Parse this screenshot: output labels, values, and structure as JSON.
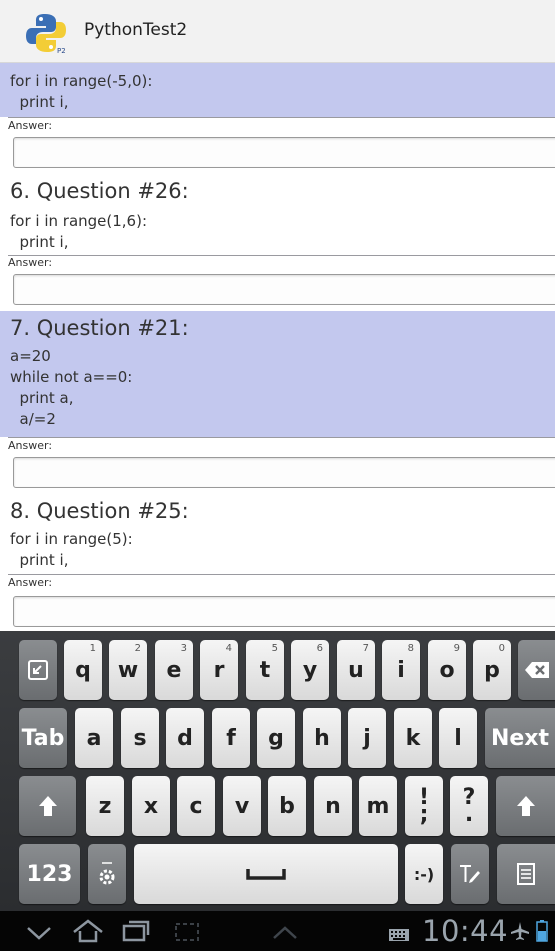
{
  "app": {
    "title": "PythonTest2"
  },
  "questions": [
    {
      "title": "",
      "code": "for i in range(-5,0):\n  print i,",
      "answer_label": "Answer:",
      "answer_value": "",
      "highlighted": true
    },
    {
      "title": "6. Question #26:",
      "code": "for i in range(1,6):\n  print i,",
      "answer_label": "Answer:",
      "answer_value": "",
      "highlighted": false
    },
    {
      "title": "7. Question #21:",
      "code": "a=20\nwhile not a==0:\n  print a,\n  a/=2",
      "answer_label": "Answer:",
      "answer_value": "",
      "highlighted": true
    },
    {
      "title": "8. Question #25:",
      "code": "for i in range(5):\n  print i,",
      "answer_label": "Answer:",
      "answer_value": "",
      "highlighted": false
    }
  ],
  "keyboard": {
    "row1": [
      {
        "label": "q",
        "hint": "1"
      },
      {
        "label": "w",
        "hint": "2"
      },
      {
        "label": "e",
        "hint": "3"
      },
      {
        "label": "r",
        "hint": "4"
      },
      {
        "label": "t",
        "hint": "5"
      },
      {
        "label": "y",
        "hint": "6"
      },
      {
        "label": "u",
        "hint": "7"
      },
      {
        "label": "i",
        "hint": "8"
      },
      {
        "label": "o",
        "hint": "9"
      },
      {
        "label": "p",
        "hint": "0"
      }
    ],
    "row2": [
      "a",
      "s",
      "d",
      "f",
      "g",
      "h",
      "j",
      "k",
      "l"
    ],
    "row3": [
      "z",
      "x",
      "c",
      "v",
      "b",
      "n",
      "m"
    ],
    "tab_label": "Tab",
    "next_label": "Next",
    "num_label": "123",
    "smiley_label": ":-)",
    "punct1": "!\n;",
    "punct2": "?\n."
  },
  "status": {
    "time": "10:44"
  },
  "icons": [
    "python-logo-icon",
    "keyboard-switch-icon",
    "backspace-icon",
    "shift-icon",
    "settings-icon",
    "space-icon",
    "handwriting-icon",
    "clipboard-icon",
    "back-icon",
    "home-icon",
    "recent-apps-icon",
    "screenshot-icon",
    "menu-up-icon",
    "keyboard-status-icon",
    "airplane-icon",
    "battery-icon"
  ]
}
